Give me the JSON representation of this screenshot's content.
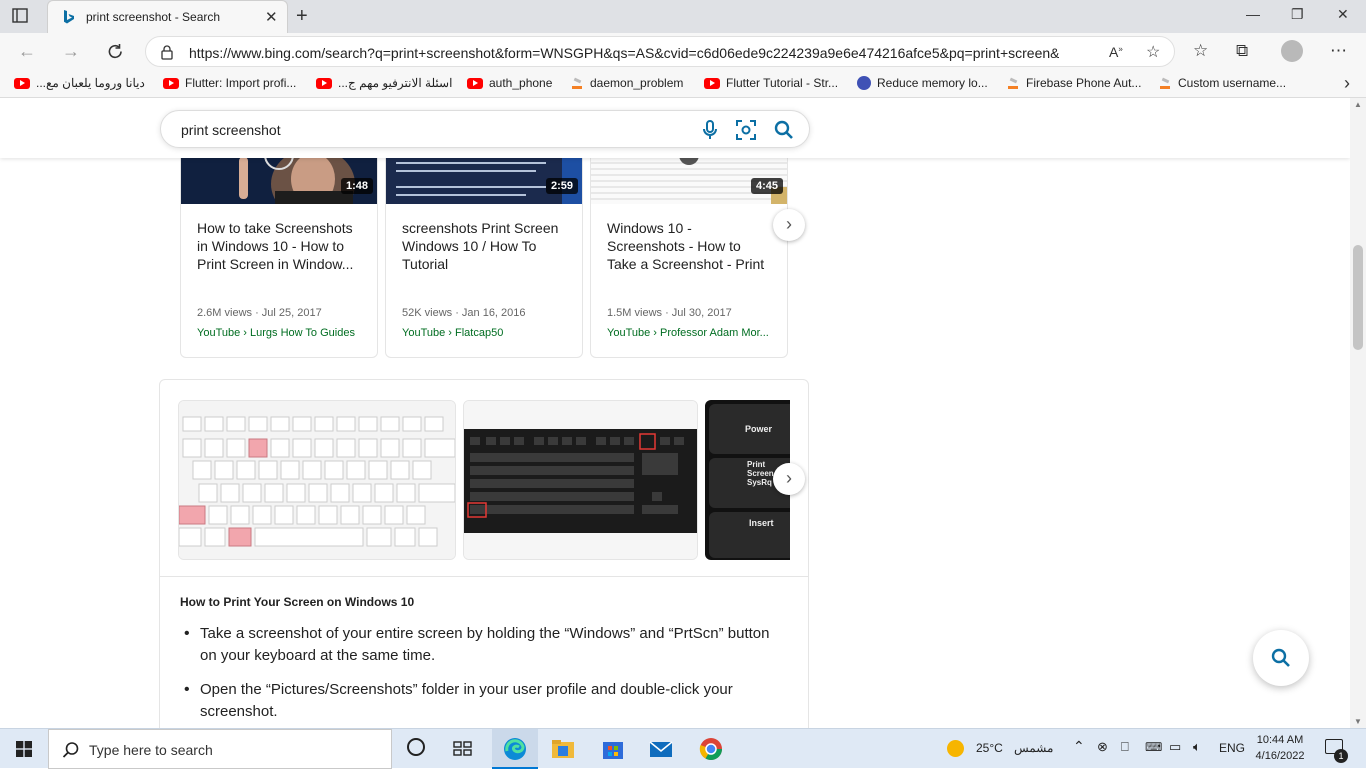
{
  "browser": {
    "tab_title": "print screenshot - Search",
    "url": "https://www.bing.com/search?q=print+screenshot&form=WNSGPH&qs=AS&cvid=c6d06ede9c224239a9e6e474216afce5&pq=print+screen&cc..."
  },
  "bookmarks": [
    {
      "label": "ديانا وروما يلعبان مع...",
      "icon": "youtube-icon"
    },
    {
      "label": "Flutter: Import profi...",
      "icon": "youtube-icon"
    },
    {
      "label": "اسئلة الانترفيو مهم ج...",
      "icon": "youtube-icon"
    },
    {
      "label": "auth_phone",
      "icon": "youtube-icon"
    },
    {
      "label": "daemon_problem",
      "icon": "stackoverflow-icon"
    },
    {
      "label": "Flutter Tutorial - Str...",
      "icon": "youtube-icon"
    },
    {
      "label": "Reduce memory lo...",
      "icon": "shield-icon"
    },
    {
      "label": "Firebase Phone Aut...",
      "icon": "stackoverflow-icon"
    },
    {
      "label": "Custom username...",
      "icon": "stackoverflow-icon"
    }
  ],
  "search": {
    "query": "print screenshot"
  },
  "videos": [
    {
      "duration": "1:48",
      "title": "How to take Screenshots in Windows 10 - How to Print Screen in Window...",
      "meta": "2.6M views · Jul 25, 2017",
      "source": "YouTube › Lurgs How To Guides"
    },
    {
      "duration": "2:59",
      "title": "screenshots Print Screen Windows 10 / How To Tutorial",
      "meta": "52K views · Jan 16, 2016",
      "source": "YouTube › Flatcap50"
    },
    {
      "duration": "4:45",
      "title": "Windows 10 - Screenshots - How to Take a Screenshot - Print Scree...",
      "meta": "1.5M views · Jul 30, 2017",
      "source": "YouTube › Professor Adam Mor..."
    }
  ],
  "answer": {
    "heading": "How to Print Your Screen on Windows 10",
    "bullets": [
      "Take a screenshot of your entire screen by holding the “Windows” and “PrtScn” button on your keyboard at the same time.",
      "Open the “Pictures/Screenshots” folder in your user profile and double-click your screenshot."
    ],
    "keys": {
      "power": "Power",
      "print1": "Print",
      "print2": "Screen",
      "print3": "SysRq",
      "insert": "Insert"
    }
  },
  "taskbar": {
    "search_placeholder": "Type here to search",
    "weather_temp": "25°C",
    "weather_label": "مشمس",
    "language": "ENG",
    "time": "10:44 AM",
    "date": "4/16/2022",
    "notifications": "1"
  },
  "colors": {
    "bing_blue": "#0c6fa4",
    "source_green": "#006d21",
    "accent": "#0078d4"
  }
}
